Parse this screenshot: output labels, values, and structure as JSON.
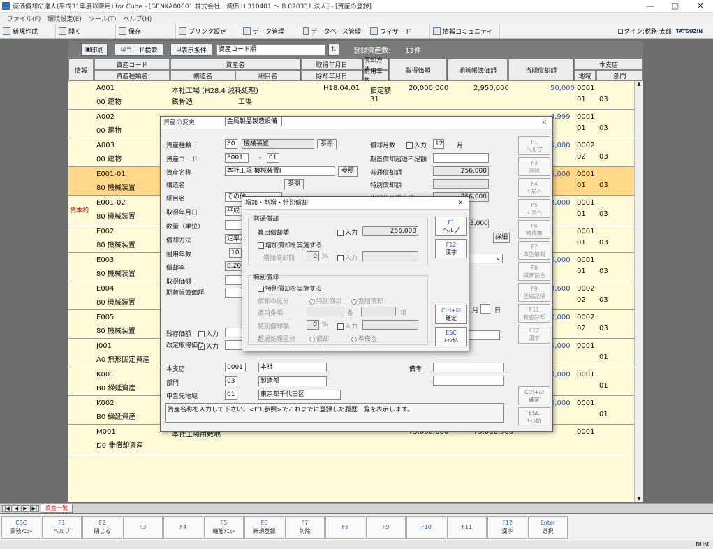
{
  "window": {
    "title": "減価償却の達人(平成31年度以降用) for Cube - [GENKA00001 株式会社　減価 H.310401 〜 R.020331 法人] - [資産の登録]",
    "min": "—",
    "max": "▢",
    "close": "✕"
  },
  "menu": [
    "ファイル(F)",
    "環境設定(E)",
    "ツール(T)",
    "ヘルプ(H)"
  ],
  "toolbar": {
    "items": [
      "新規作成",
      "開く",
      "保存",
      "プリンタ設定",
      "データ管理",
      "データベース管理",
      "ウィザード",
      "情報コミュニティ"
    ],
    "login": "ログイン:税務 太郎",
    "brand": "TATSUZIN"
  },
  "controls": {
    "print": "印刷",
    "code_search": "コード検索",
    "display": "表示条件",
    "sort_value": "資産コード順",
    "count_label": "登録資産数：",
    "count": "13件"
  },
  "header": {
    "info": "情報",
    "asset_code": "資産コード",
    "asset_type": "資産種類名",
    "asset_name": "資産名",
    "struct": "構造名",
    "detail": "細目名",
    "acq_date": "取得年月日",
    "disp_date": "除却年月日",
    "method": "償却方法",
    "life": "耐用年数",
    "acq_value": "取得価額",
    "begin_book": "期首帳簿価額",
    "depr": "当期償却額",
    "branch": "本支店",
    "region": "地域",
    "dept": "部門"
  },
  "rows": [
    {
      "info": "",
      "code": "A001",
      "type": "00 建物",
      "name": "本社工場 (H28.4 減耗処理)",
      "struct": "鉄骨造",
      "detail": "工場",
      "acq": "H18.04.01",
      "method": "旧定額",
      "life": "31",
      "acqv": "20,000,000",
      "book": "2,950,000",
      "depr": "50,000",
      "b1": "0001",
      "b2": "01",
      "b3": "03"
    },
    {
      "info": "",
      "code": "A002",
      "type": "00 建物",
      "name": "",
      "struct": "",
      "detail": "",
      "acq": "",
      "method": "",
      "life": "",
      "acqv": "",
      "book": "",
      "depr": "4,999",
      "b1": "0001",
      "b2": "01",
      "b3": "03"
    },
    {
      "info": "",
      "code": "A003",
      "type": "00 建物",
      "name": "",
      "struct": "",
      "detail": "",
      "acq": "",
      "method": "",
      "life": "",
      "acqv": "",
      "book": "",
      "depr": "5,000",
      "b1": "0002",
      "b2": "02",
      "b3": "03"
    },
    {
      "info": "",
      "code": "E001-01",
      "type": "80 機械装置",
      "name": "",
      "struct": "",
      "detail": "",
      "acq": "",
      "method": "",
      "life": "",
      "acqv": "",
      "book": "",
      "depr": "6,000",
      "b1": "0001",
      "b2": "01",
      "b3": "03"
    },
    {
      "info": "資本的",
      "code": "E001-02",
      "type": "80 機械装置",
      "name": "",
      "struct": "",
      "detail": "",
      "acq": "",
      "method": "",
      "life": "",
      "acqv": "",
      "book": "",
      "depr": "2,000",
      "b1": "0001",
      "b2": "01",
      "b3": "03"
    },
    {
      "info": "",
      "code": "E002",
      "type": "80 機械装置",
      "name": "",
      "struct": "",
      "detail": "",
      "acq": "",
      "method": "",
      "life": "",
      "acqv": "",
      "book": "",
      "depr": "",
      "b1": "0001",
      "b2": "01",
      "b3": "03"
    },
    {
      "info": "",
      "code": "E003",
      "type": "80 機械装置",
      "name": "",
      "struct": "",
      "detail": "",
      "acq": "",
      "method": "",
      "life": "",
      "acqv": "",
      "book": "",
      "depr": "0,000",
      "b1": "0001",
      "b2": "01",
      "b3": "03"
    },
    {
      "info": "",
      "code": "E004",
      "type": "80 機械装置",
      "name": "",
      "struct": "",
      "detail": "",
      "acq": "",
      "method": "",
      "life": "",
      "acqv": "",
      "book": "",
      "depr": "3,600",
      "b1": "0002",
      "b2": "02",
      "b3": "03"
    },
    {
      "info": "",
      "code": "E005",
      "type": "80 機械装置",
      "name": "",
      "struct": "",
      "detail": "",
      "acq": "",
      "method": "",
      "life": "",
      "acqv": "",
      "book": "",
      "depr": "0,000",
      "b1": "0002",
      "b2": "02",
      "b3": "03"
    },
    {
      "info": "",
      "code": "J001",
      "type": "A0 無形固定資産",
      "name": "",
      "struct": "",
      "detail": "",
      "acq": "",
      "method": "",
      "life": "",
      "acqv": "",
      "book": "",
      "depr": "0,000",
      "b1": "0001",
      "b2": "",
      "b3": "01"
    },
    {
      "info": "",
      "code": "K001",
      "type": "B0 繰延資産",
      "name": "",
      "struct": "",
      "detail": "",
      "acq": "",
      "method": "",
      "life": "",
      "acqv": "",
      "book": "",
      "depr": "0,000",
      "b1": "0001",
      "b2": "",
      "b3": "01"
    },
    {
      "info": "",
      "code": "K002",
      "type": "B0 繰延資産",
      "name": "",
      "struct": "",
      "detail": "",
      "acq": "",
      "method": "",
      "life": "",
      "acqv": "",
      "book": "",
      "depr": "0,000",
      "b1": "0001",
      "b2": "",
      "b3": "01"
    },
    {
      "info": "",
      "code": "M001",
      "type": "D0 非償却資産",
      "name": "本社工場用敷地",
      "struct": "",
      "detail": "",
      "acq": "",
      "method": "",
      "life": "",
      "acqv": "75,000,000",
      "book": "75,000,000",
      "depr": "",
      "b1": "0001",
      "b2": "",
      "b3": ""
    }
  ],
  "tab": "資産一覧",
  "fkeys": [
    {
      "k": "ESC",
      "l": "業務ﾒﾆｭｰ"
    },
    {
      "k": "F1",
      "l": "ヘルプ"
    },
    {
      "k": "F2",
      "l": "閉じる"
    },
    {
      "k": "F3",
      "l": ""
    },
    {
      "k": "F4",
      "l": ""
    },
    {
      "k": "F5",
      "l": "機能ﾒﾆｭｰ"
    },
    {
      "k": "F6",
      "l": "新規登録"
    },
    {
      "k": "F7",
      "l": "削除"
    },
    {
      "k": "F8",
      "l": ""
    },
    {
      "k": "F9",
      "l": ""
    },
    {
      "k": "F10",
      "l": ""
    },
    {
      "k": "F11",
      "l": ""
    },
    {
      "k": "F12",
      "l": "漢字"
    },
    {
      "k": "Enter",
      "l": "選択"
    }
  ],
  "status": "NUM",
  "dlg": {
    "title": "資産の変更",
    "close": "✕",
    "l_type": "資産種類",
    "v_type_c": "80",
    "v_type": "機械装置",
    "ref": "参照",
    "l_code": "資産コード",
    "v_code1": "E001",
    "dash": "-",
    "v_code2": "01",
    "l_name": "資産名称",
    "v_name": "本社工場 機械装置Ⅰ",
    "l_struct": "構造名",
    "v_struct": "金属製品製造設備",
    "l_detail": "細目名",
    "v_detail": "その他",
    "l_acq": "取得年月日",
    "v_acq": "平成",
    "l_qty": "数量（単位）",
    "l_method": "償却方法",
    "v_method": "定率法",
    "l_life": "耐用年数",
    "v_life": "10",
    "l_rate": "償却率",
    "v_rate": "0.200",
    "l_acqv": "取得価額",
    "l_book": "期首帳簿価額",
    "l_left": "残存価額",
    "l_opt": "改定取得価額",
    "input": "入力",
    "l_months": "償却月数",
    "v_months": "12",
    "month": "月",
    "l_short": "期首償却超過不足額",
    "l_normal": "普通償却額",
    "v_normal": "256,000",
    "l_special": "特別償却額",
    "l_total": "当期償却限度額",
    "v_total": "256,000",
    "v_b1": "3,000",
    "detail": "詳細",
    "l_branch": "本支店",
    "v_branch_c": "0001",
    "v_branch": "本社",
    "l_dept": "部門",
    "v_dept_c": "03",
    "v_dept": "製造部",
    "l_region": "申告先地域",
    "v_region_c": "01",
    "v_region": "東京都千代田区",
    "l_note": "備考",
    "msg": "資産名称を入力して下さい。<F3:参照>でこれまでに登録した履歴一覧を表示します。",
    "side": [
      {
        "k": "F1",
        "l": "ヘルプ"
      },
      {
        "k": "F3",
        "l": "参照"
      },
      {
        "k": "F4",
        "l": "↑前へ"
      },
      {
        "k": "F5",
        "l": "↓次へ"
      },
      {
        "k": "F6",
        "l": "特償等"
      },
      {
        "k": "F7",
        "l": "申告情報"
      },
      {
        "k": "F8",
        "l": "減価割合"
      },
      {
        "k": "F9",
        "l": "圧縮記帳"
      },
      {
        "k": "F11",
        "l": "有姿除却"
      },
      {
        "k": "F12",
        "l": "漢字"
      }
    ],
    "ctrl": "Ctrl+☑",
    "ctrl_l": "確定",
    "esc": "ESC",
    "esc_l": "ｷｬﾝｾﾙ",
    "date_m": "月",
    "date_d": "日"
  },
  "dlg2": {
    "title": "増加・割増・特別償却",
    "close": "✕",
    "g1": "普通償却",
    "l_calc": "算出償却額",
    "v_calc": "256,000",
    "c_inc": "増加償却を実施する",
    "l_inc": "増加償却額",
    "v_inc": "0",
    "pct": "%",
    "g2": "特別償却",
    "c_sp": "特別償却を実施する",
    "l_kind": "償却の区分",
    "r1": "特別償却",
    "r2": "割増償却",
    "l_law": "適用条項",
    "jo": "条",
    "kou": "項",
    "l_spv": "特別償却額",
    "v_spv": "0",
    "l_rem": "超過処理区分",
    "r3": "償却",
    "r4": "準備金",
    "f1": "F1",
    "f1l": "ヘルプ",
    "f12": "F12",
    "f12l": "漢字",
    "ok": "Ctrl+☑",
    "okl": "確定",
    "esc": "ESC",
    "escl": "ｷｬﾝｾﾙ"
  }
}
